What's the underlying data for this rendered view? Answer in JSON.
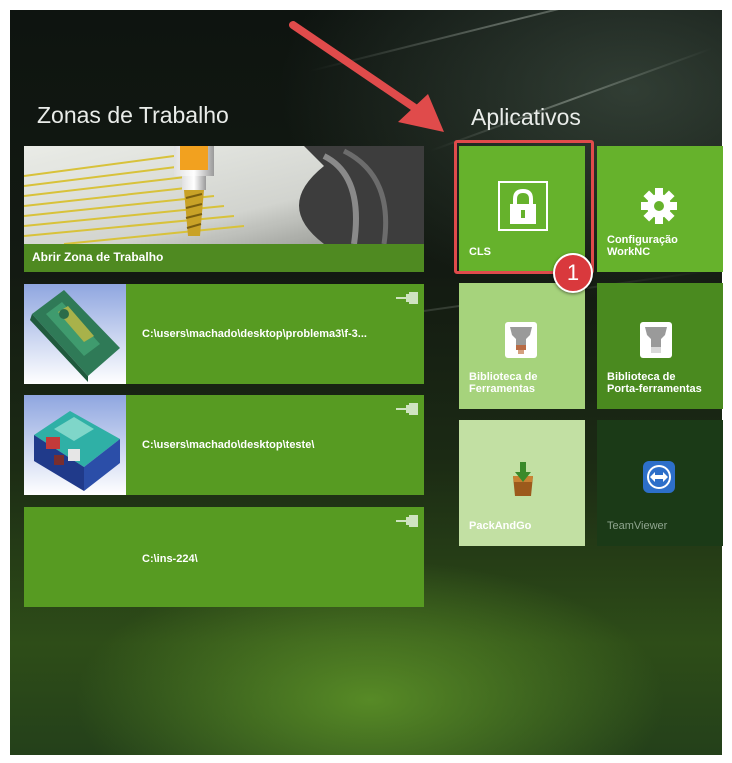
{
  "workspaces": {
    "title": "Zonas de Trabalho",
    "open_label": "Abrir Zona de Trabalho",
    "recent": [
      {
        "path": "C:\\users\\machado\\desktop\\problema3\\f-3..."
      },
      {
        "path": "C:\\users\\machado\\desktop\\teste\\"
      },
      {
        "path": "C:\\ins-224\\"
      }
    ]
  },
  "apps": {
    "title": "Aplicativos",
    "tiles": [
      {
        "label": "CLS",
        "icon": "lock-icon",
        "color": "#66b22c"
      },
      {
        "label": "Configuração\nWorkNC",
        "icon": "gear-icon",
        "color": "#66b22c"
      },
      {
        "label": "Biblioteca de\nFerramentas",
        "icon": "tool-holder-icon",
        "color": "#a6d37c"
      },
      {
        "label": "Biblioteca de\nPorta-ferramentas",
        "icon": "tool-holder-icon",
        "color": "#4a8a1f"
      },
      {
        "label": "PackAndGo",
        "icon": "package-download-icon",
        "color": "#c2e0a3"
      },
      {
        "label": "TeamViewer",
        "icon": "teamviewer-icon",
        "color": "#1b3a17"
      }
    ]
  },
  "annotation": {
    "badge_number": "1",
    "highlight_color": "#e04b4b"
  }
}
